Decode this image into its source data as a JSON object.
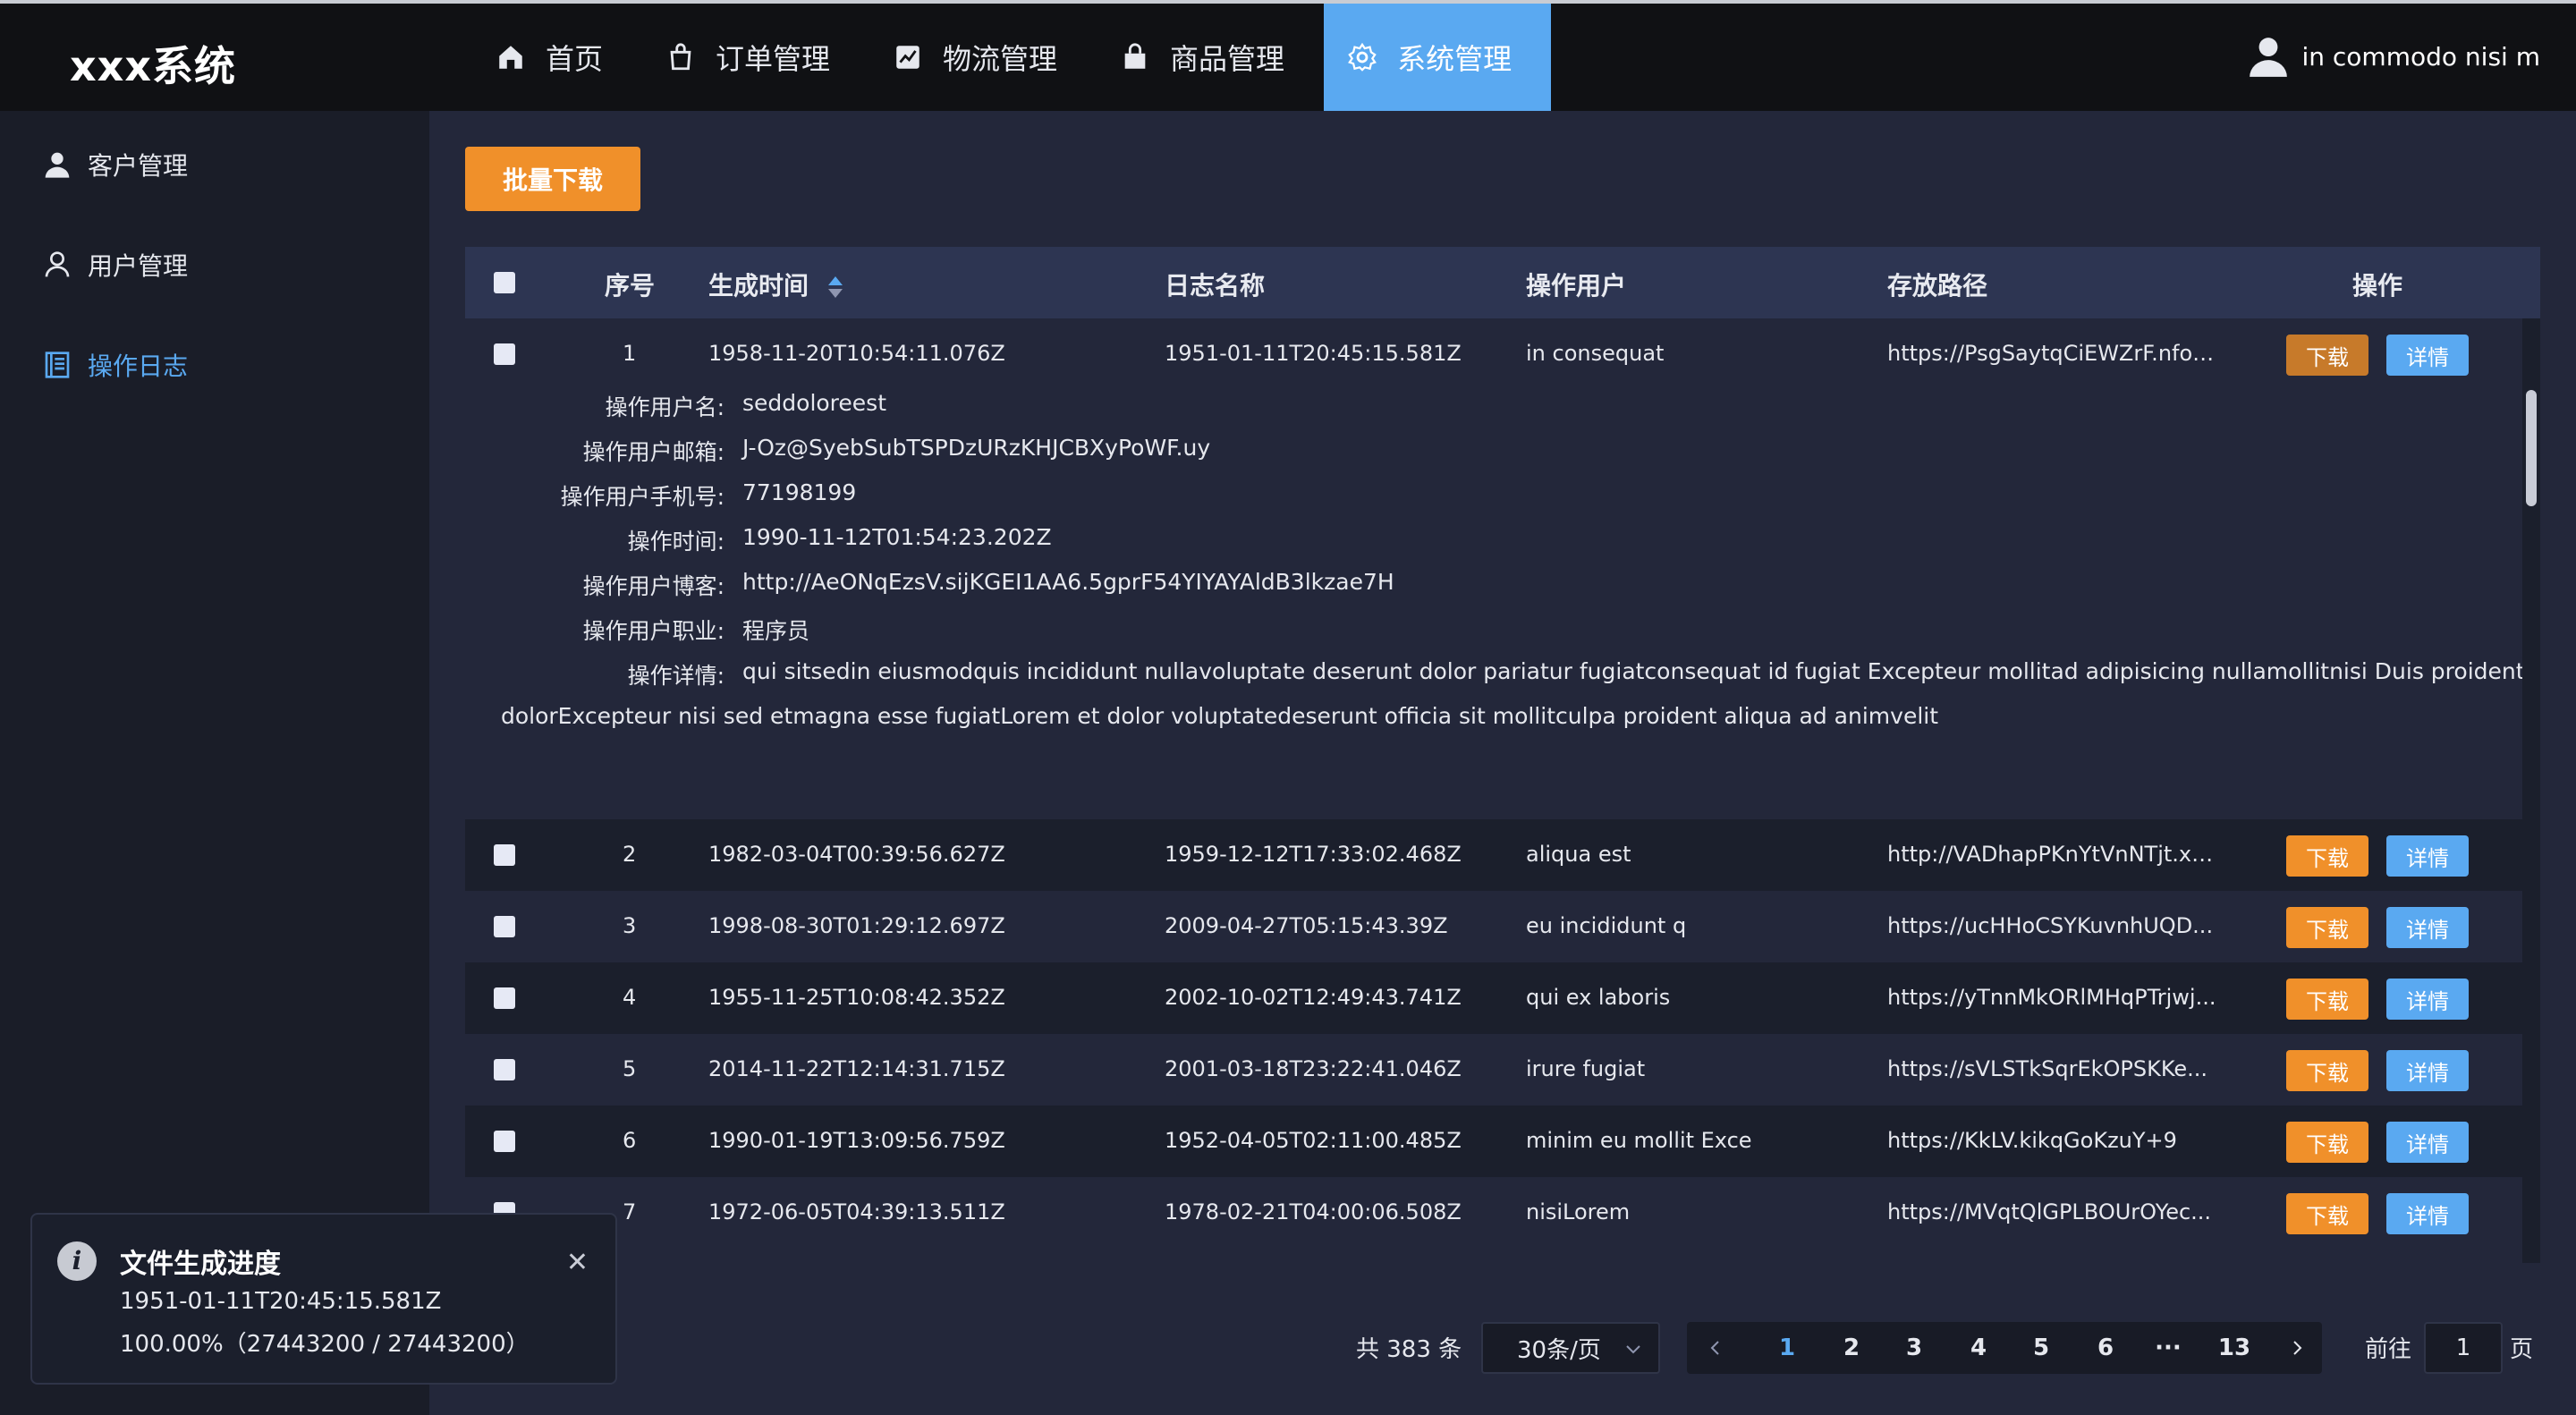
{
  "app": {
    "logo": "xxx系统"
  },
  "nav": {
    "items": [
      {
        "label": "首页",
        "icon": "home-icon"
      },
      {
        "label": "订单管理",
        "icon": "order-icon"
      },
      {
        "label": "物流管理",
        "icon": "chart-icon"
      },
      {
        "label": "商品管理",
        "icon": "bag-icon"
      },
      {
        "label": "系统管理",
        "icon": "gear-icon",
        "active": true
      }
    ],
    "user": "in commodo nisi m"
  },
  "sidebar": {
    "items": [
      {
        "label": "客户管理",
        "icon": "customer-icon"
      },
      {
        "label": "用户管理",
        "icon": "user-icon"
      },
      {
        "label": "操作日志",
        "icon": "log-icon",
        "active": true
      }
    ]
  },
  "toolbar": {
    "batch_download": "批量下载"
  },
  "table": {
    "headers": {
      "index": "序号",
      "time": "生成时间",
      "name": "日志名称",
      "user": "操作用户",
      "path": "存放路径",
      "ops": "操作"
    },
    "actions": {
      "download": "下载",
      "detail": "详情"
    },
    "rows": [
      {
        "index": "1",
        "time": "1958-11-20T10:54:11.076Z",
        "name": "1951-01-11T20:45:15.581Z",
        "user": "in consequat",
        "path": "https://PsgSaytqCiEWZrF.nfosaq"
      },
      {
        "index": "2",
        "time": "1982-03-04T00:39:56.627Z",
        "name": "1959-12-12T17:33:02.468Z",
        "user": "aliqua est",
        "path": "http://VADhapPKnYtVnNTjt.xv..."
      },
      {
        "index": "3",
        "time": "1998-08-30T01:29:12.697Z",
        "name": "2009-04-27T05:15:43.39Z",
        "user": "eu incididunt q",
        "path": "https://ucHHoCSYKuvnhUQD..."
      },
      {
        "index": "4",
        "time": "1955-11-25T10:08:42.352Z",
        "name": "2002-10-02T12:49:43.741Z",
        "user": "qui ex laboris",
        "path": "https://yTnnMkORlMHqPTrjwj..."
      },
      {
        "index": "5",
        "time": "2014-11-22T12:14:31.715Z",
        "name": "2001-03-18T23:22:41.046Z",
        "user": "irure fugiat",
        "path": "https://sVLSTkSqrEkOPSKKe..."
      },
      {
        "index": "6",
        "time": "1990-01-19T13:09:56.759Z",
        "name": "1952-04-05T02:11:00.485Z",
        "user": "minim eu mollit Exce",
        "path": "https://KkLV.kikqGoKzuY+9"
      },
      {
        "index": "7",
        "time": "1972-06-05T04:39:13.511Z",
        "name": "1978-02-21T04:00:06.508Z",
        "user": "nisiLorem",
        "path": "https://MVqtQlGPLBOUrOYec..."
      }
    ],
    "expanded": {
      "fields": [
        {
          "label": "操作用户名:",
          "value": "seddoloreest"
        },
        {
          "label": "操作用户邮箱:",
          "value": "J-Oz@SyebSubTSPDzURzKHJCBXyPoWF.uy"
        },
        {
          "label": "操作用户手机号:",
          "value": "77198199"
        },
        {
          "label": "操作时间:",
          "value": "1990-11-12T01:54:23.202Z"
        },
        {
          "label": "操作用户博客:",
          "value": "http://AeONqEzsV.sijKGEI1AA6.5gprF54YIYAYAldB3lkzae7H"
        },
        {
          "label": "操作用户职业:",
          "value": "程序员"
        },
        {
          "label": "操作详情:",
          "value": "qui sitsedin eiusmodquis incididunt nullavoluptate deserunt dolor pariatur fugiatconsequat id fugiat Excepteur mollitad adipisicing nullamollitnisi Duis proident laboreesse"
        }
      ],
      "detail_continued": "dolorExcepteur nisi sed etmagna esse fugiatLorem et dolor voluptatedeserunt officia sit mollitculpa proident aliqua ad animvelit"
    }
  },
  "pagination": {
    "total": "共 383 条",
    "page_size": "30条/页",
    "pages": [
      "1",
      "2",
      "3",
      "4",
      "5",
      "6",
      "···",
      "13"
    ],
    "current": "1",
    "goto_label": "前往",
    "goto_value": "1",
    "goto_unit": "页"
  },
  "notification": {
    "title": "文件生成进度",
    "file": "1951-01-11T20:45:15.581Z",
    "progress": "100.00%（27443200 / 27443200）"
  },
  "colors": {
    "accent": "#5aa9f1",
    "download": "#f0902a",
    "header_bg": "#101114",
    "body_bg": "#23273a"
  }
}
